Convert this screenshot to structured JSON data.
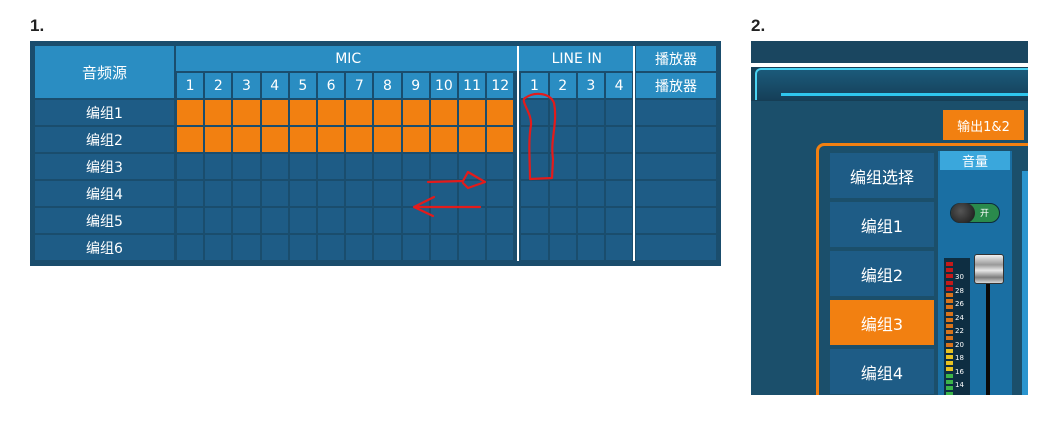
{
  "sections": {
    "label1": "1.",
    "label2": "2."
  },
  "matrix": {
    "source_header": "音频源",
    "groups": {
      "mic": "MIC",
      "line_in": "LINE IN",
      "player": "播放器"
    },
    "mic_channels": [
      "1",
      "2",
      "3",
      "4",
      "5",
      "6",
      "7",
      "8",
      "9",
      "10",
      "11",
      "12"
    ],
    "line_channels": [
      "1",
      "2",
      "3",
      "4"
    ],
    "player_subheader": "播放器",
    "rows": [
      {
        "label": "编组1",
        "mic_on": [
          1,
          1,
          1,
          1,
          1,
          1,
          1,
          1,
          1,
          1,
          1,
          1
        ],
        "line_on": [
          0,
          0,
          0,
          0
        ],
        "player_on": 0
      },
      {
        "label": "编组2",
        "mic_on": [
          1,
          1,
          1,
          1,
          1,
          1,
          1,
          1,
          1,
          1,
          1,
          1
        ],
        "line_on": [
          0,
          0,
          0,
          0
        ],
        "player_on": 0
      },
      {
        "label": "编组3",
        "mic_on": [
          0,
          0,
          0,
          0,
          0,
          0,
          0,
          0,
          0,
          0,
          0,
          0
        ],
        "line_on": [
          0,
          0,
          0,
          0
        ],
        "player_on": 0
      },
      {
        "label": "编组4",
        "mic_on": [
          0,
          0,
          0,
          0,
          0,
          0,
          0,
          0,
          0,
          0,
          0,
          0
        ],
        "line_on": [
          0,
          0,
          0,
          0
        ],
        "player_on": 0
      },
      {
        "label": "编组5",
        "mic_on": [
          0,
          0,
          0,
          0,
          0,
          0,
          0,
          0,
          0,
          0,
          0,
          0
        ],
        "line_on": [
          0,
          0,
          0,
          0
        ],
        "player_on": 0
      },
      {
        "label": "编组6",
        "mic_on": [
          0,
          0,
          0,
          0,
          0,
          0,
          0,
          0,
          0,
          0,
          0,
          0
        ],
        "line_on": [
          0,
          0,
          0,
          0
        ],
        "player_on": 0
      }
    ],
    "colors": {
      "active": "#f28011",
      "cell": "#1e5c86",
      "header": "#2a8dc2",
      "annotation": "#e31b1b"
    }
  },
  "panel2": {
    "output_button": "输出1&2",
    "group_select_label": "编组选择",
    "groups": [
      "编组1",
      "编组2",
      "编组3",
      "编组4"
    ],
    "selected_group": "编组3",
    "volume_header": "音量",
    "toggle_label": "开",
    "toggle_state": "on",
    "meter_scale": [
      "30",
      "28",
      "26",
      "24",
      "22",
      "20",
      "18",
      "16",
      "14"
    ],
    "fader_level": 0.95
  }
}
